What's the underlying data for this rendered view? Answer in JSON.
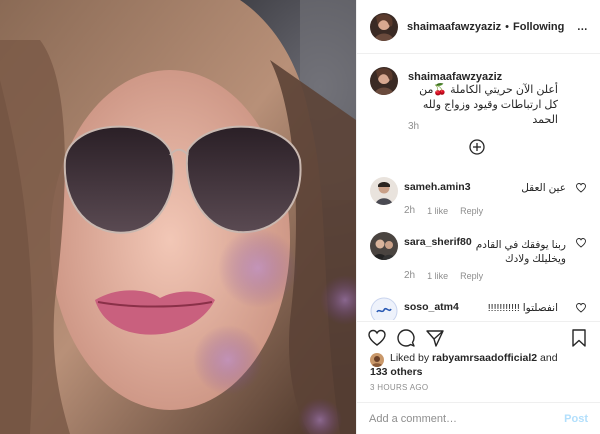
{
  "header": {
    "username": "shaimaafawzyaziz",
    "separator": "•",
    "follow_status": "Following",
    "more_label": "..."
  },
  "caption": {
    "username": "shaimaafawzyaziz",
    "text": "أعلن الآن حريتي الكاملة 🍒من كل ارتباطات وقيود وزواج ولله الحمد",
    "time": "3h"
  },
  "comments": [
    {
      "username": "sameh.amin3",
      "text": "عين العقل",
      "time": "2h",
      "likes": "1 like",
      "reply": "Reply"
    },
    {
      "username": "sara_sherif80",
      "text": "ربنا يوفقك في القادم ويخليلك ولادك",
      "time": "2h",
      "likes": "1 like",
      "reply": "Reply"
    },
    {
      "username": "soso_atm4",
      "text": "انفصلتوا !!!!!!!!!!!",
      "time": "",
      "likes": "",
      "reply": ""
    }
  ],
  "likes": {
    "prefix": "Liked by",
    "first_liker": "rabyamrsaadofficial2",
    "conjunction": "and",
    "others": "133 others"
  },
  "posted_time": "3 HOURS AGO",
  "add_comment": {
    "placeholder": "Add a comment…",
    "post_label": "Post"
  },
  "icons": {
    "more": "more-icon",
    "load_more": "plus-circle-icon",
    "heart": "heart-icon",
    "comment": "comment-icon",
    "share": "share-icon",
    "save": "bookmark-icon"
  }
}
